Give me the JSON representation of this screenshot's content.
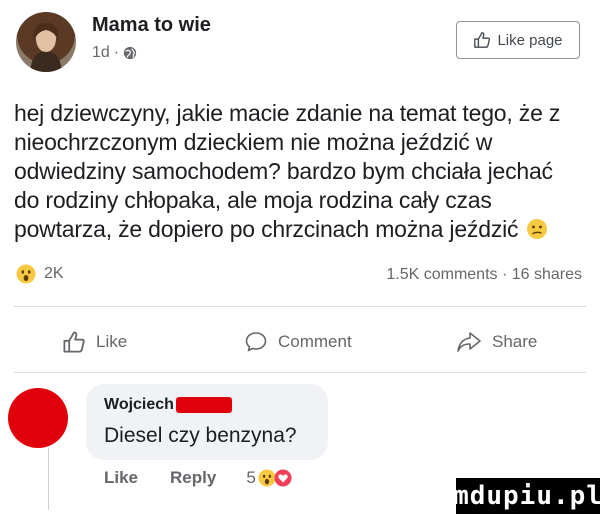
{
  "post": {
    "page_name": "Mama to wie",
    "time": "1d",
    "time_separator": "·",
    "like_page_label": "Like page",
    "text_lines": [
      "hej dziewczyny, jakie macie zdanie na temat tego, że z",
      "nieochrzczonym dzieckiem nie można jeździć w",
      "odwiedziny samochodem? bardzo bym chciała jechać",
      "do rodziny chłopaka, ale moja rodzina cały czas",
      "powtarza, że dopiero po chrzcinach można jeździć"
    ],
    "text_emoji": "confused-face",
    "reaction_icon": "wow-emoji",
    "reaction_count": "2K",
    "stats": "1.5K comments · 16 shares"
  },
  "actions": {
    "like": "Like",
    "comment": "Comment",
    "share": "Share"
  },
  "comment": {
    "author": "Wojciech",
    "text": "Diesel czy benzyna?",
    "like_label": "Like",
    "reply_label": "Reply",
    "reaction_count": "5"
  },
  "watermark": "mdupiu.pl",
  "colors": {
    "secondary_text": "#65676b",
    "bubble": "#f0f2f5",
    "redaction": "#e0000b",
    "wow_yellow": "#f7c842",
    "love_red": "#f33e58"
  }
}
